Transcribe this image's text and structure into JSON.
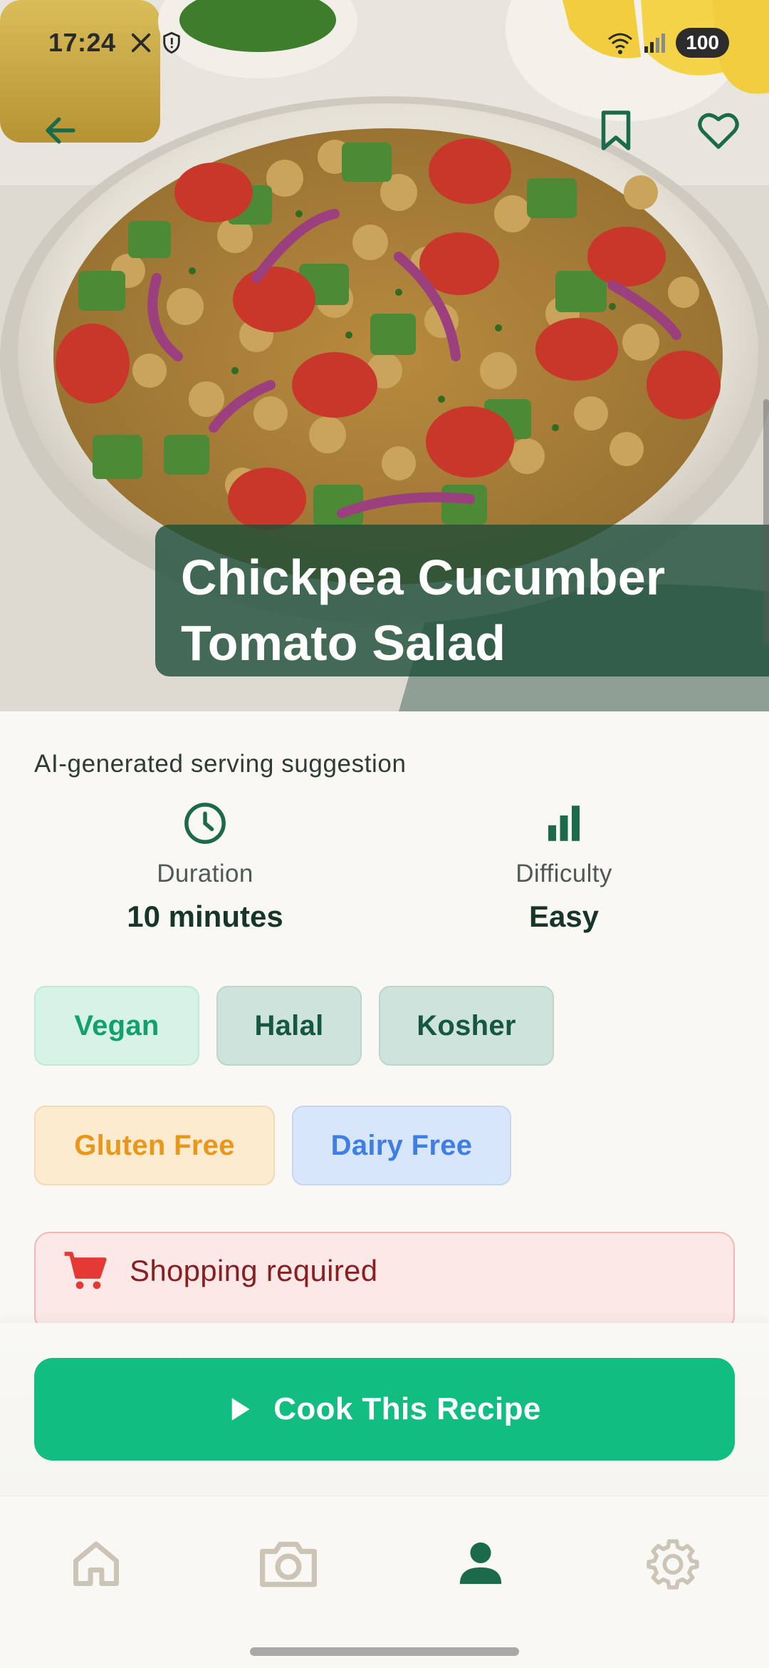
{
  "status_bar": {
    "time": "17:24",
    "battery": "100",
    "icons": [
      "x-icon",
      "shield-icon",
      "wifi-icon",
      "signal-icon"
    ]
  },
  "header": {
    "back_icon": "arrow-left-icon",
    "bookmark_icon": "bookmark-icon",
    "favorite_icon": "heart-icon"
  },
  "recipe": {
    "title": "Chickpea Cucumber Tomato Salad",
    "image_caption": "AI-generated serving suggestion",
    "duration_label": "Duration",
    "duration_value": "10 minutes",
    "difficulty_label": "Difficulty",
    "difficulty_value": "Easy",
    "tags": [
      "Vegan",
      "Halal",
      "Kosher",
      "Gluten Free",
      "Dairy Free"
    ],
    "shopping_notice": "Shopping required"
  },
  "actions": {
    "cook_button": "Cook This Recipe"
  },
  "nav": {
    "items": [
      "home-icon",
      "camera-icon",
      "profile-icon",
      "settings-icon"
    ],
    "active": "profile-icon"
  },
  "colors": {
    "brand_green": "#12bd81",
    "dark_green": "#1b6b4b",
    "title_panel": "#1b4e38",
    "shopping_red": "#e53935"
  }
}
